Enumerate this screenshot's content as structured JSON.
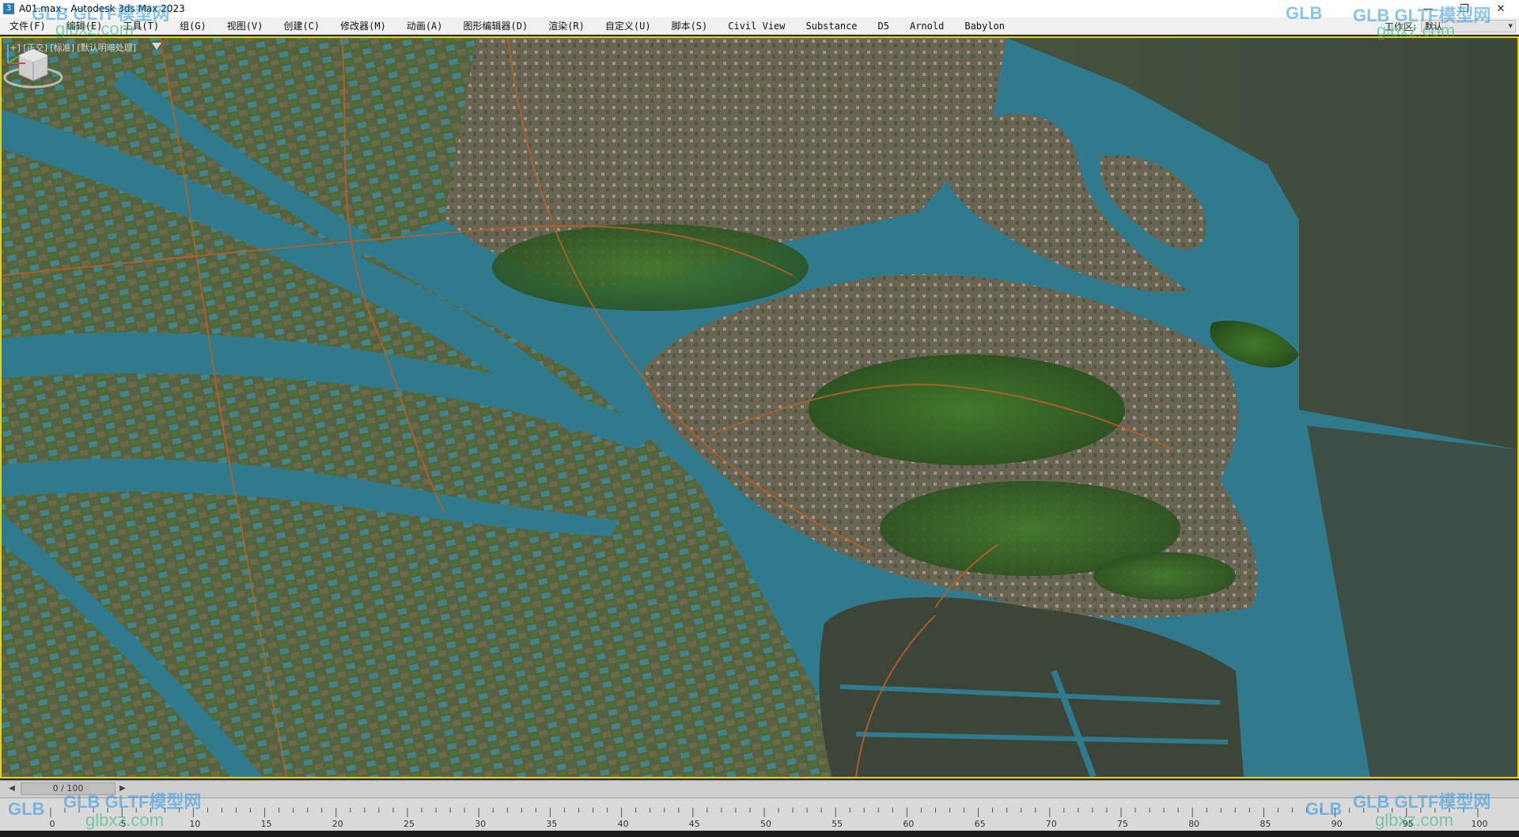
{
  "titlebar": {
    "title": "A01.max - Autodesk 3ds Max 2023",
    "app_icon": "3",
    "controls": {
      "minimize": "—",
      "maximize": "❐",
      "close": "✕"
    }
  },
  "menu": {
    "items": [
      {
        "label": "文件(F)"
      },
      {
        "label": "编辑(E)"
      },
      {
        "label": "工具(T)"
      },
      {
        "label": "组(G)"
      },
      {
        "label": "视图(V)"
      },
      {
        "label": "创建(C)"
      },
      {
        "label": "修改器(M)"
      },
      {
        "label": "动画(A)"
      },
      {
        "label": "图形编辑器(D)"
      },
      {
        "label": "渲染(R)"
      },
      {
        "label": "自定义(U)"
      },
      {
        "label": "脚本(S)"
      },
      {
        "label": "Civil View"
      },
      {
        "label": "Substance"
      },
      {
        "label": "D5"
      },
      {
        "label": "Arnold"
      },
      {
        "label": "Babylon"
      }
    ],
    "workspace_label": "工作区:",
    "workspace_value": "默认"
  },
  "viewport": {
    "label": "[+] [正交] [标准] [默认明暗处理]",
    "active_border_color": "#e3d31a",
    "water_color": "#2f7a8c",
    "land_color": "#4a5a2e"
  },
  "timeline": {
    "frame_readout": "0 / 100",
    "ticks": [
      0,
      5,
      10,
      15,
      20,
      25,
      30,
      35,
      40,
      45,
      50,
      55,
      60,
      65,
      70,
      75,
      80,
      85,
      90,
      95,
      100
    ]
  },
  "watermarks": {
    "brand": "GLB GLTF模型网",
    "site": "glbxz.com",
    "logo": "GLB"
  }
}
